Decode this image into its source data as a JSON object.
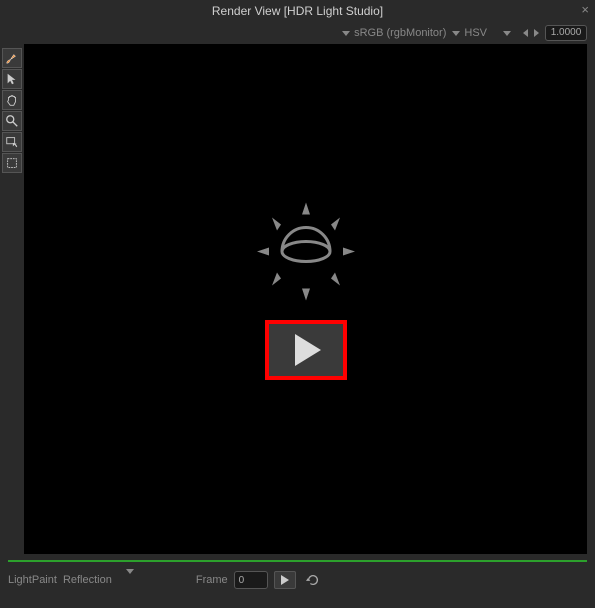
{
  "titlebar": {
    "title": "Render View [HDR Light Studio]"
  },
  "topbar": {
    "colorspace": "sRGB (rgbMonitor)",
    "colormodel": "HSV",
    "zoom": "1.0000"
  },
  "bottom": {
    "lightpaint_label": "LightPaint",
    "mode": "Reflection",
    "frame_label": "Frame",
    "frame_value": "0"
  }
}
